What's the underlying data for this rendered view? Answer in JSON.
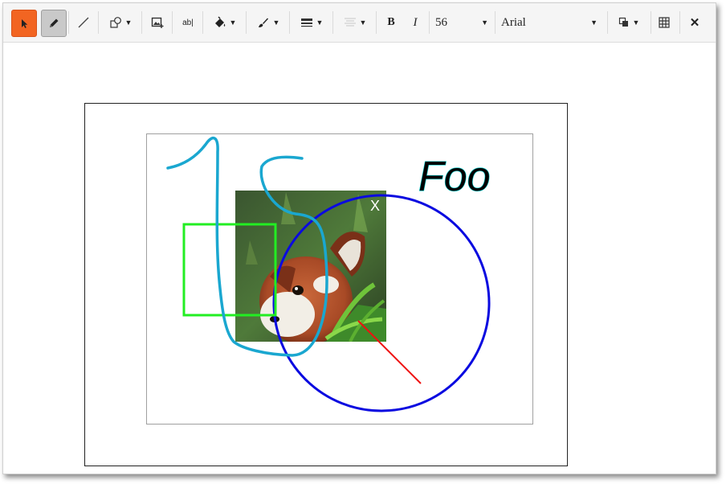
{
  "toolbar": {
    "tools": {
      "select": "select-arrow-icon",
      "pencil": "pencil-icon",
      "line": "line-icon",
      "shapes": "shapes-icon",
      "image": "add-image-icon",
      "text": "text-tool-icon",
      "fill": "fill-bucket-icon",
      "brush": "brush-icon",
      "line_width": "line-width-icon",
      "align": "text-align-icon",
      "arrange": "arrange-icon",
      "grid": "grid-icon",
      "close": "close-icon"
    },
    "text_tool_label": "ab|",
    "bold_label": "B",
    "italic_label": "I",
    "font_size": "56",
    "font_family": "Arial",
    "close_label": "✕",
    "active_color": "#f26522"
  },
  "drawing": {
    "text_object": "Foo",
    "image": "red-panda",
    "image_close_label": "X",
    "stroke_colors": {
      "scribble": "#1aa7d0",
      "rectangle": "#22ee22",
      "circle": "#0a0ae0",
      "line": "#ee1111",
      "text_outline": "#00cfcf"
    }
  }
}
